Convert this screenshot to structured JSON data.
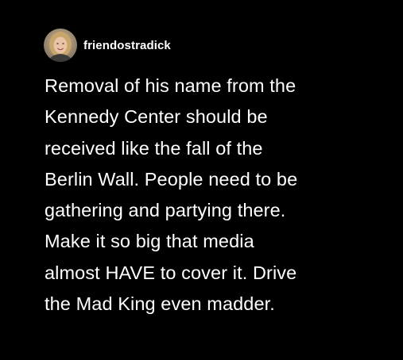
{
  "post": {
    "author": {
      "username": "friendostradick",
      "avatar_icon": "profile-photo-avatar"
    },
    "text_lines": [
      "Removal of his name from the",
      "Kennedy Center should be",
      "received like the fall of the",
      "Berlin Wall. People need to be",
      "gathering and partying there.",
      "Make it so big that media",
      "almost HAVE to cover it. Drive",
      "the Mad King even madder."
    ]
  },
  "colors": {
    "background": "#000000",
    "text": "#ffffff"
  }
}
